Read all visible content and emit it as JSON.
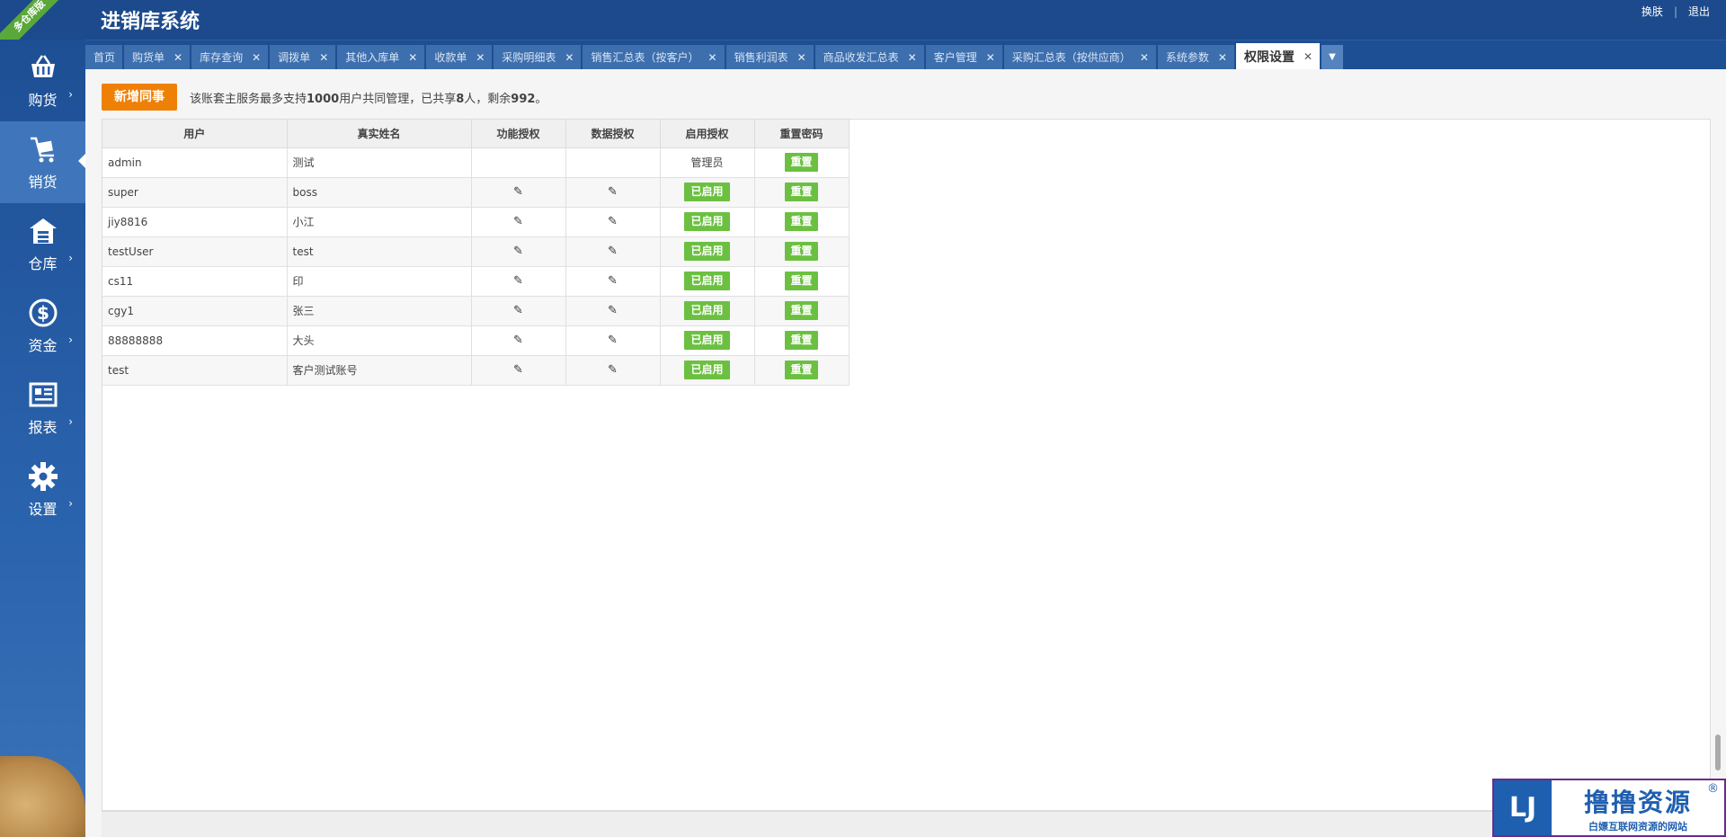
{
  "header": {
    "ribbon": "多仓库版",
    "title": "进销库系统",
    "links": [
      "换肤",
      "退出"
    ]
  },
  "sidebar": {
    "items": [
      {
        "label": "购货",
        "icon": "basket-icon"
      },
      {
        "label": "销货",
        "icon": "cart-icon",
        "active": true
      },
      {
        "label": "仓库",
        "icon": "warehouse-icon"
      },
      {
        "label": "资金",
        "icon": "dollar-icon"
      },
      {
        "label": "报表",
        "icon": "report-icon"
      },
      {
        "label": "设置",
        "icon": "gear-icon"
      }
    ]
  },
  "tabs": [
    {
      "label": "首页",
      "closable": false
    },
    {
      "label": "购货单",
      "closable": true
    },
    {
      "label": "库存查询",
      "closable": true
    },
    {
      "label": "调拨单",
      "closable": true
    },
    {
      "label": "其他入库单",
      "closable": true
    },
    {
      "label": "收款单",
      "closable": true
    },
    {
      "label": "采购明细表",
      "closable": true
    },
    {
      "label": "销售汇总表（按客户）",
      "closable": true
    },
    {
      "label": "销售利润表",
      "closable": true
    },
    {
      "label": "商品收发汇总表",
      "closable": true
    },
    {
      "label": "客户管理",
      "closable": true
    },
    {
      "label": "采购汇总表（按供应商）",
      "closable": true
    },
    {
      "label": "系统参数",
      "closable": true
    },
    {
      "label": "权限设置",
      "closable": true,
      "active": true
    }
  ],
  "toolbar": {
    "add_button": "新增同事",
    "notice_pre": "该账套主服务最多支持",
    "notice_max": "1000",
    "notice_mid": "用户共同管理，已共享",
    "notice_count": "8",
    "notice_mid2": "人，剩余",
    "notice_remain": "992",
    "notice_end": "。"
  },
  "grid": {
    "columns": [
      "用户",
      "真实姓名",
      "功能授权",
      "数据授权",
      "启用授权",
      "重置密码"
    ],
    "rows": [
      {
        "user": "admin",
        "name": "测试",
        "func": "",
        "data": "",
        "status": "管理员",
        "reset": "重置"
      },
      {
        "user": "super",
        "name": "boss",
        "func": "✎",
        "data": "✎",
        "status": "已启用",
        "reset": "重置"
      },
      {
        "user": "jiy8816",
        "name": "小江",
        "func": "✎",
        "data": "✎",
        "status": "已启用",
        "reset": "重置"
      },
      {
        "user": "testUser",
        "name": "test",
        "func": "✎",
        "data": "✎",
        "status": "已启用",
        "reset": "重置"
      },
      {
        "user": "cs11",
        "name": "印",
        "func": "✎",
        "data": "✎",
        "status": "已启用",
        "reset": "重置"
      },
      {
        "user": "cgy1",
        "name": "张三",
        "func": "✎",
        "data": "✎",
        "status": "已启用",
        "reset": "重置"
      },
      {
        "user": "88888888",
        "name": "大头",
        "func": "✎",
        "data": "✎",
        "status": "已启用",
        "reset": "重置"
      },
      {
        "user": "test",
        "name": "客户测试账号",
        "func": "✎",
        "data": "✎",
        "status": "已启用",
        "reset": "重置"
      }
    ]
  },
  "watermark": {
    "logo": "LJ",
    "main": "撸撸资源",
    "sub": "白嫖互联网资源的网站",
    "reg": "®"
  }
}
